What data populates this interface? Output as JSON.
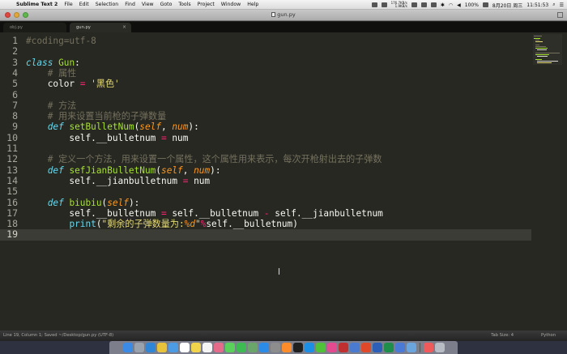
{
  "menubar": {
    "app_name": "Sublime Text 2",
    "items": [
      "File",
      "Edit",
      "Selection",
      "Find",
      "View",
      "Goto",
      "Tools",
      "Project",
      "Window",
      "Help"
    ],
    "network_up": "176.7KB/s",
    "network_down": "1.9KB/s",
    "battery": "100%",
    "date": "8月20日 周三",
    "time": "11:51:53"
  },
  "window": {
    "title": "gun.py",
    "icon": "document-icon"
  },
  "tabs": [
    {
      "label": "obj.py",
      "active": false
    },
    {
      "label": "gun.py",
      "active": true
    }
  ],
  "editor": {
    "current_line": 19,
    "lines": [
      {
        "n": "1",
        "tokens": [
          {
            "c": "cm",
            "t": "#coding=utf-8"
          }
        ]
      },
      {
        "n": "2",
        "tokens": []
      },
      {
        "n": "3",
        "tokens": [
          {
            "c": "kw",
            "t": "class"
          },
          {
            "c": "",
            "t": " "
          },
          {
            "c": "fn",
            "t": "Gun"
          },
          {
            "c": "",
            "t": ":"
          }
        ]
      },
      {
        "n": "4",
        "tokens": [
          {
            "c": "",
            "t": "    "
          },
          {
            "c": "cm",
            "t": "# 属性"
          }
        ]
      },
      {
        "n": "5",
        "tokens": [
          {
            "c": "",
            "t": "    color "
          },
          {
            "c": "op",
            "t": "="
          },
          {
            "c": "",
            "t": " "
          },
          {
            "c": "st",
            "t": "'黑色'"
          }
        ]
      },
      {
        "n": "6",
        "tokens": []
      },
      {
        "n": "7",
        "tokens": [
          {
            "c": "",
            "t": "    "
          },
          {
            "c": "cm",
            "t": "# 方法"
          }
        ]
      },
      {
        "n": "8",
        "tokens": [
          {
            "c": "",
            "t": "    "
          },
          {
            "c": "cm",
            "t": "# 用来设置当前枪的子弹数量"
          }
        ]
      },
      {
        "n": "9",
        "tokens": [
          {
            "c": "",
            "t": "    "
          },
          {
            "c": "kw",
            "t": "def"
          },
          {
            "c": "",
            "t": " "
          },
          {
            "c": "fn",
            "t": "setBulletNum"
          },
          {
            "c": "",
            "t": "("
          },
          {
            "c": "pm",
            "t": "self"
          },
          {
            "c": "",
            "t": ", "
          },
          {
            "c": "pm",
            "t": "num"
          },
          {
            "c": "",
            "t": "):"
          }
        ]
      },
      {
        "n": "10",
        "tokens": [
          {
            "c": "",
            "t": "        self.__bulletnum "
          },
          {
            "c": "op",
            "t": "="
          },
          {
            "c": "",
            "t": " num"
          }
        ]
      },
      {
        "n": "11",
        "tokens": []
      },
      {
        "n": "12",
        "tokens": [
          {
            "c": "",
            "t": "    "
          },
          {
            "c": "cm",
            "t": "# 定义一个方法，用来设置一个属性，这个属性用来表示，每次开枪射出去的子弹数"
          }
        ]
      },
      {
        "n": "13",
        "tokens": [
          {
            "c": "",
            "t": "    "
          },
          {
            "c": "kw",
            "t": "def"
          },
          {
            "c": "",
            "t": " "
          },
          {
            "c": "fn",
            "t": "sefJianBulletNum"
          },
          {
            "c": "",
            "t": "("
          },
          {
            "c": "pm",
            "t": "self"
          },
          {
            "c": "",
            "t": ", "
          },
          {
            "c": "pm",
            "t": "num"
          },
          {
            "c": "",
            "t": "):"
          }
        ]
      },
      {
        "n": "14",
        "tokens": [
          {
            "c": "",
            "t": "        self.__jianbulletnum "
          },
          {
            "c": "op",
            "t": "="
          },
          {
            "c": "",
            "t": " num"
          }
        ]
      },
      {
        "n": "15",
        "tokens": []
      },
      {
        "n": "16",
        "tokens": [
          {
            "c": "",
            "t": "    "
          },
          {
            "c": "kw",
            "t": "def"
          },
          {
            "c": "",
            "t": " "
          },
          {
            "c": "fn",
            "t": "biubiu"
          },
          {
            "c": "",
            "t": "("
          },
          {
            "c": "pm",
            "t": "self"
          },
          {
            "c": "",
            "t": "):"
          }
        ]
      },
      {
        "n": "17",
        "tokens": [
          {
            "c": "",
            "t": "        self.__bulletnum "
          },
          {
            "c": "op",
            "t": "="
          },
          {
            "c": "",
            "t": " self.__bulletnum "
          },
          {
            "c": "op",
            "t": "-"
          },
          {
            "c": "",
            "t": " self.__jianbulletnum"
          }
        ]
      },
      {
        "n": "18",
        "tokens": [
          {
            "c": "",
            "t": "        "
          },
          {
            "c": "bi",
            "t": "print"
          },
          {
            "c": "",
            "t": "("
          },
          {
            "c": "st",
            "t": "\"剩余的子弹数量为:"
          },
          {
            "c": "pm",
            "t": "%d"
          },
          {
            "c": "st",
            "t": "\""
          },
          {
            "c": "op",
            "t": "%"
          },
          {
            "c": "",
            "t": "self.__bulletnum)"
          }
        ]
      },
      {
        "n": "19",
        "tokens": []
      }
    ]
  },
  "statusbar": {
    "left": "Line 19, Column 1; Saved ~/Desktop/gun.py (UTF-8)",
    "tab_size": "Tab Size: 4",
    "syntax": "Python"
  },
  "colors": {
    "editor_bg": "#272822",
    "comment": "#75715e",
    "keyword": "#66d9ef",
    "string": "#e6db74",
    "function": "#a6e22e",
    "param": "#fd971f",
    "operator": "#f92672"
  },
  "dock_icons": [
    "finder-icon",
    "launchpad-icon",
    "safari-icon",
    "chrome-icon",
    "mail-icon",
    "calendar-icon",
    "notes-icon",
    "reminders-icon",
    "photos-icon",
    "messages-icon",
    "facetime-icon",
    "maps-icon",
    "app-store-icon",
    "settings-icon",
    "sublime-icon",
    "terminal-icon",
    "qq-icon",
    "wechat-icon",
    "itunes-icon",
    "video-icon",
    "xcode-icon",
    "office-icon",
    "word-icon",
    "excel-icon",
    "keynote-icon",
    "preview-icon",
    "music-icon",
    "trash-icon"
  ]
}
